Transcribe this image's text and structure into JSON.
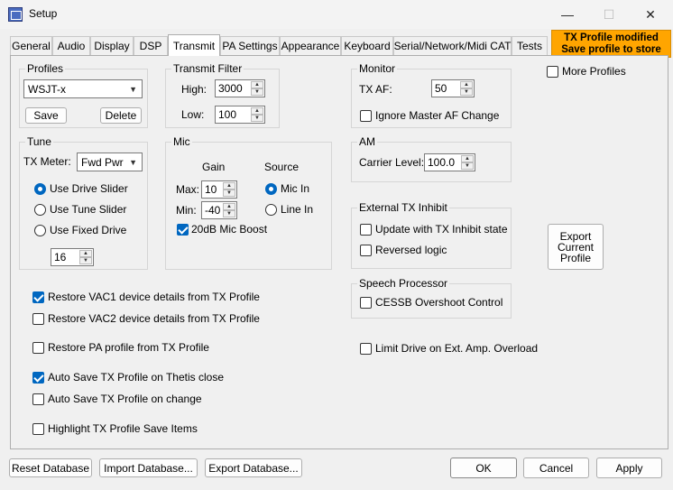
{
  "window": {
    "title": "Setup",
    "minimize": "—",
    "maximize": "☐",
    "close": "✕"
  },
  "tabs": [
    "General",
    "Audio",
    "Display",
    "DSP",
    "Transmit",
    "PA Settings",
    "Appearance",
    "Keyboard",
    "Serial/Network/Midi CAT",
    "Tests"
  ],
  "banner": {
    "line1": "TX Profile modified",
    "line2": "Save profile to store"
  },
  "profiles": {
    "label": "Profiles",
    "selected": "WSJT-x",
    "save": "Save",
    "delete": "Delete"
  },
  "transmit_filter": {
    "label": "Transmit Filter",
    "high_label": "High:",
    "high_value": "3000",
    "low_label": "Low:",
    "low_value": "100"
  },
  "monitor": {
    "label": "Monitor",
    "txaf_label": "TX AF:",
    "txaf_value": "50",
    "ignore_master": "Ignore Master AF Change"
  },
  "more_profiles": "More Profiles",
  "tune": {
    "label": "Tune",
    "meter_label": "TX Meter:",
    "meter_value": "Fwd Pwr",
    "use_drive": "Use Drive Slider",
    "use_tune": "Use Tune Slider",
    "use_fixed": "Use Fixed Drive",
    "fixed_value": "16"
  },
  "mic": {
    "label": "Mic",
    "gain": "Gain",
    "source": "Source",
    "max_label": "Max:",
    "max_value": "10",
    "min_label": "Min:",
    "min_value": "-40",
    "mic_in": "Mic In",
    "line_in": "Line In",
    "boost": "20dB Mic Boost"
  },
  "am": {
    "label": "AM",
    "carrier_label": "Carrier Level:",
    "carrier_value": "100.0"
  },
  "ext_inhibit": {
    "label": "External TX Inhibit",
    "update": "Update with TX Inhibit state",
    "reversed": "Reversed logic"
  },
  "export_profile": {
    "line1": "Export",
    "line2": "Current",
    "line3": "Profile"
  },
  "speech": {
    "label": "Speech Processor",
    "cessb": "CESSB Overshoot Control"
  },
  "options": {
    "restore_vac1": "Restore VAC1 device details from TX Profile",
    "restore_vac2": "Restore VAC2 device details from TX Profile",
    "restore_pa": "Restore PA profile from TX Profile",
    "auto_save_close": "Auto Save TX Profile on Thetis close",
    "auto_save_change": "Auto Save TX Profile on change",
    "highlight": "Highlight TX Profile Save Items",
    "limit_drive": "Limit Drive on Ext. Amp. Overload"
  },
  "footer": {
    "reset": "Reset Database",
    "import": "Import Database...",
    "export": "Export Database...",
    "ok": "OK",
    "cancel": "Cancel",
    "apply": "Apply"
  },
  "colors": {
    "accent": "#0067c0",
    "banner": "#ffa500"
  }
}
